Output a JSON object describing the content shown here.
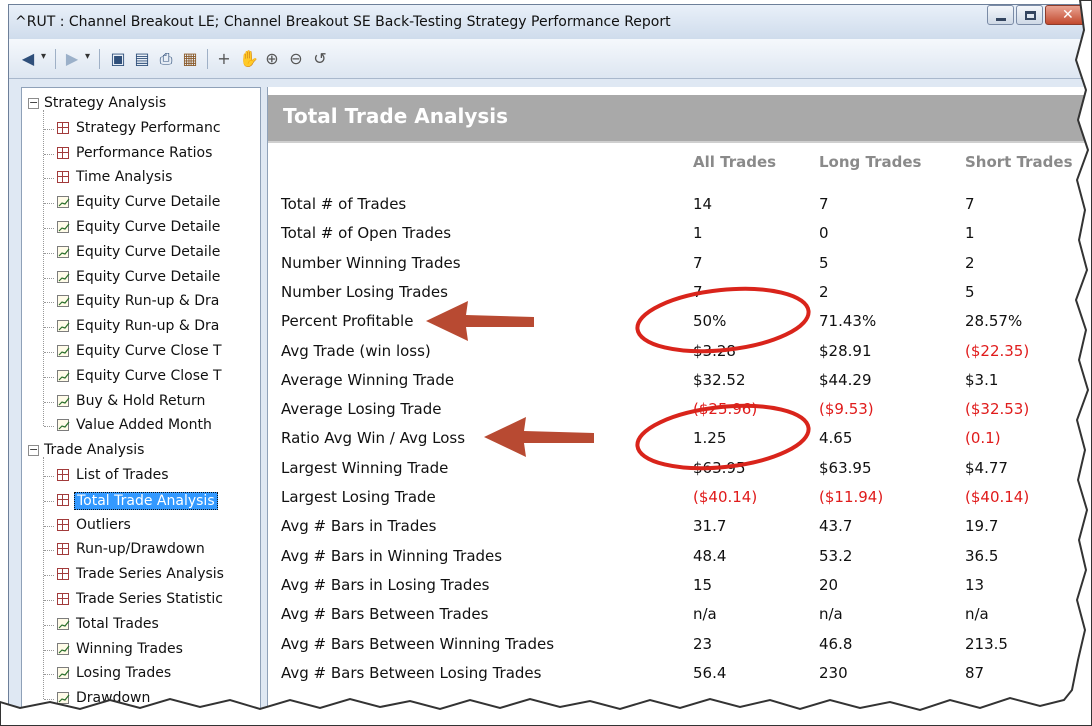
{
  "window": {
    "title": "^RUT : Channel Breakout LE; Channel Breakout SE Back-Testing Strategy Performance Report"
  },
  "toolbar": {
    "icons": [
      "back-arrow-icon",
      "forward-arrow-icon",
      "save-icon",
      "print-preview-icon",
      "print-icon",
      "table-view-icon",
      "crosshair-icon",
      "hand-pan-icon",
      "zoom-in-icon",
      "zoom-out-icon",
      "reset-zoom-icon"
    ]
  },
  "sidebar": {
    "groups": [
      {
        "label": "Strategy Analysis",
        "items": [
          {
            "label": "Strategy Performanc",
            "icon": "table"
          },
          {
            "label": "Performance Ratios",
            "icon": "table"
          },
          {
            "label": "Time Analysis",
            "icon": "table"
          },
          {
            "label": "Equity Curve Detaile",
            "icon": "chart"
          },
          {
            "label": "Equity Curve Detaile",
            "icon": "chart"
          },
          {
            "label": "Equity Curve Detaile",
            "icon": "chart"
          },
          {
            "label": "Equity Curve Detaile",
            "icon": "chart"
          },
          {
            "label": "Equity Run-up & Dra",
            "icon": "chart"
          },
          {
            "label": "Equity Run-up & Dra",
            "icon": "chart"
          },
          {
            "label": "Equity Curve Close T",
            "icon": "chart"
          },
          {
            "label": "Equity Curve Close T",
            "icon": "chart"
          },
          {
            "label": "Buy & Hold Return",
            "icon": "chart"
          },
          {
            "label": "Value Added Month",
            "icon": "chart"
          }
        ]
      },
      {
        "label": "Trade Analysis",
        "items": [
          {
            "label": "List of Trades",
            "icon": "table"
          },
          {
            "label": "Total Trade Analysis",
            "icon": "table",
            "selected": true
          },
          {
            "label": "Outliers",
            "icon": "table"
          },
          {
            "label": "Run-up/Drawdown",
            "icon": "table"
          },
          {
            "label": "Trade Series Analysis",
            "icon": "table"
          },
          {
            "label": "Trade Series Statistic",
            "icon": "table"
          },
          {
            "label": "Total Trades",
            "icon": "chart"
          },
          {
            "label": "Winning Trades",
            "icon": "chart"
          },
          {
            "label": "Losing Trades",
            "icon": "chart"
          },
          {
            "label": "Drawdown",
            "icon": "chart"
          }
        ]
      }
    ]
  },
  "report": {
    "title": "Total Trade Analysis",
    "columns": [
      "All Trades",
      "Long Trades",
      "Short Trades"
    ],
    "rows": [
      {
        "label": "Total # of Trades",
        "values": [
          "14",
          "7",
          "7"
        ]
      },
      {
        "label": "Total # of Open Trades",
        "values": [
          "1",
          "0",
          "1"
        ]
      },
      {
        "label": "Number Winning Trades",
        "values": [
          "7",
          "5",
          "2"
        ]
      },
      {
        "label": "Number Losing Trades",
        "values": [
          "7",
          "2",
          "5"
        ]
      },
      {
        "label": "Percent Profitable",
        "values": [
          "50%",
          "71.43%",
          "28.57%"
        ]
      },
      {
        "label": "Avg Trade (win  loss)",
        "values": [
          "$3.28",
          "$28.91",
          "($22.35)"
        ]
      },
      {
        "label": "Average Winning Trade",
        "values": [
          "$32.52",
          "$44.29",
          "$3.1"
        ]
      },
      {
        "label": "Average Losing Trade",
        "values": [
          "($25.96)",
          "($9.53)",
          "($32.53)"
        ]
      },
      {
        "label": "Ratio Avg Win / Avg Loss",
        "values": [
          "1.25",
          "4.65",
          "(0.1)"
        ]
      },
      {
        "label": "Largest Winning Trade",
        "values": [
          "$63.95",
          "$63.95",
          "$4.77"
        ]
      },
      {
        "label": "Largest Losing Trade",
        "values": [
          "($40.14)",
          "($11.94)",
          "($40.14)"
        ]
      },
      {
        "label": "Avg # Bars in Trades",
        "values": [
          "31.7",
          "43.7",
          "19.7"
        ]
      },
      {
        "label": "Avg # Bars in Winning Trades",
        "values": [
          "48.4",
          "53.2",
          "36.5"
        ]
      },
      {
        "label": "Avg # Bars in Losing Trades",
        "values": [
          "15",
          "20",
          "13"
        ]
      },
      {
        "label": "Avg # Bars Between Trades",
        "values": [
          "n/a",
          "n/a",
          "n/a"
        ]
      },
      {
        "label": "Avg # Bars Between Winning Trades",
        "values": [
          "23",
          "46.8",
          "213.5"
        ]
      },
      {
        "label": "Avg # Bars Between Losing Trades",
        "values": [
          "56.4",
          "230",
          "87"
        ]
      }
    ]
  },
  "colors": {
    "negative": "#e01b1b",
    "selection": "#3399ff",
    "annotation": "#c0392b",
    "header_band": "#a9a9a9"
  }
}
